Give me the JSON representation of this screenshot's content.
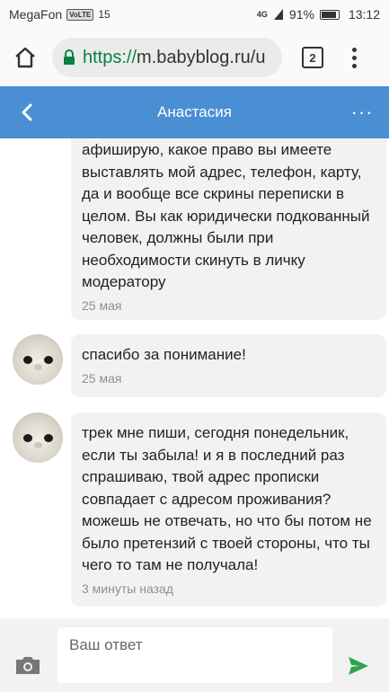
{
  "status_bar": {
    "carrier": "MegaFon",
    "volte": "VoLTE",
    "signal_label": "15",
    "network": "4G",
    "battery": "91%",
    "battery_level": 0.91,
    "time": "13:12"
  },
  "browser": {
    "url_scheme": "https://",
    "url_host": "m.babyblog.ru/u",
    "tab_count": "2"
  },
  "header": {
    "title": "Анастасия",
    "more": "···"
  },
  "messages": [
    {
      "text": "афиширую, какое право вы имеете выставлять мой адрес, телефон, карту, да и вообще все скрины переписки в целом. Вы как юридически подкованный человек, должны были при необходимости скинуть в личку модератору",
      "time": "25 мая"
    },
    {
      "text": "спасибо за понимание!",
      "time": "25 мая"
    },
    {
      "text": "трек мне пиши, сегодня понедельник, если ты забыла! и я в последний раз спрашиваю, твой адрес прописки совпадает с адресом проживания? можешь не отвечать, но что бы потом не было претензий с твоей стороны, что ты чего то там не получала!",
      "time": "3 минуты назад"
    }
  ],
  "composer": {
    "placeholder": "Ваш ответ"
  },
  "colors": {
    "header": "#4a8fd4",
    "send": "#2ea44f",
    "url_secure": "#0b8043"
  }
}
